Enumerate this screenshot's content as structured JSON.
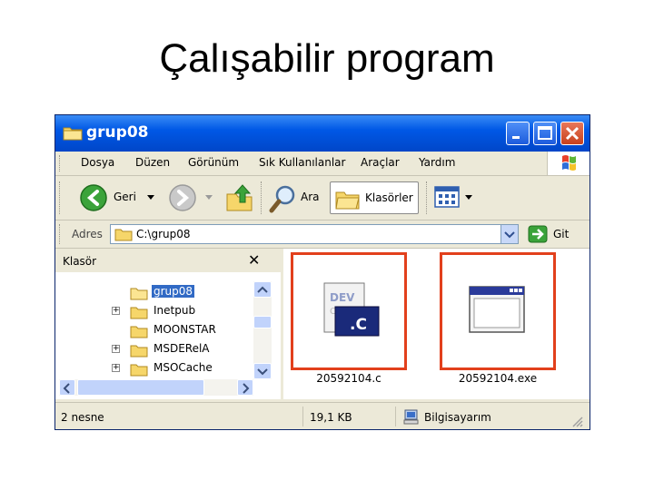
{
  "slide_title": "Çalışabilir program",
  "window": {
    "title": "grup08",
    "controls": [
      "minimize",
      "maximize",
      "close"
    ]
  },
  "menu": [
    "Dosya",
    "Düzen",
    "Görünüm",
    "Sık Kullanılanlar",
    "Araçlar",
    "Yardım"
  ],
  "toolbar": {
    "back_label": "Geri",
    "search_label": "Ara",
    "folders_label": "Klasörler"
  },
  "address": {
    "label": "Adres",
    "value": "C:\\grup08",
    "go_label": "Git"
  },
  "tree": {
    "header": "Klasör",
    "close_symbol": "✕",
    "items": [
      {
        "label": "grup08",
        "expandable": false,
        "selected": true
      },
      {
        "label": "Inetpub",
        "expandable": true,
        "selected": false
      },
      {
        "label": "MOONSTAR",
        "expandable": false,
        "selected": false
      },
      {
        "label": "MSDERelA",
        "expandable": true,
        "selected": false
      },
      {
        "label": "MSOCache",
        "expandable": true,
        "selected": false
      }
    ]
  },
  "files": [
    {
      "name": "20592104.c",
      "icon": "c-source-file-icon",
      "badge": ".C"
    },
    {
      "name": "20592104.exe",
      "icon": "executable-window-icon"
    }
  ],
  "status": {
    "count": "2 nesne",
    "size": "19,1 KB",
    "location": "Bilgisayarım"
  },
  "colors": {
    "titlebar": "#0058e6",
    "highlight": "#e2401c",
    "selection": "#316ac5"
  }
}
